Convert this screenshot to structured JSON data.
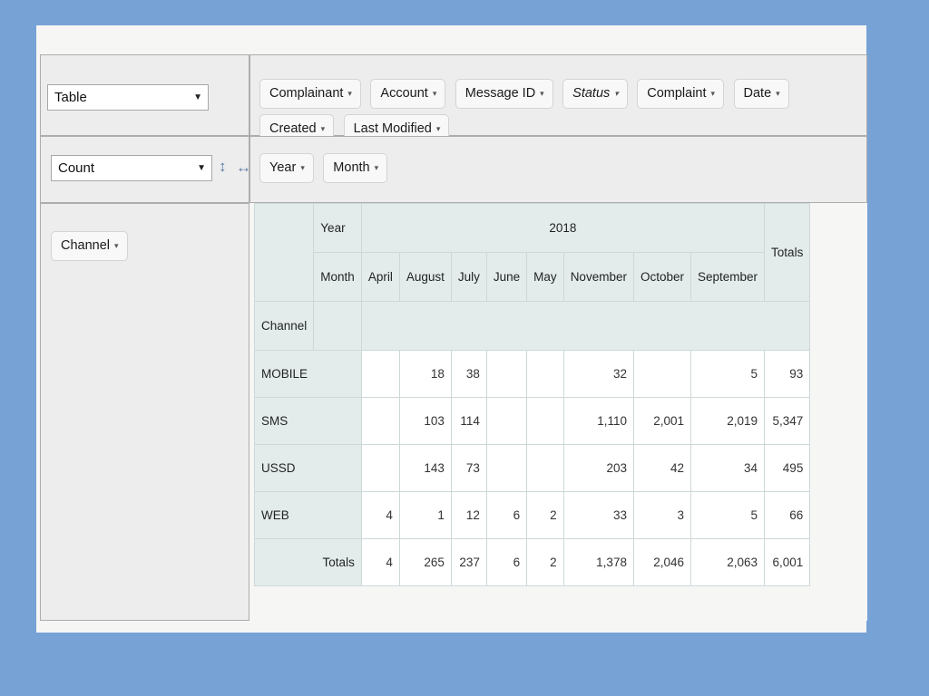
{
  "renderer": {
    "label": "Table",
    "caret": "▼"
  },
  "aggregator": {
    "label": "Count",
    "caret": "▼",
    "vertical_arrow_icon": "↕",
    "horizontal_arrow_icon": "↔"
  },
  "unused_attributes": [
    {
      "label": "Complainant",
      "caret": "▾",
      "italic": false
    },
    {
      "label": "Account",
      "caret": "▾",
      "italic": false
    },
    {
      "label": "Message ID",
      "caret": "▾",
      "italic": false
    },
    {
      "label": "Status",
      "caret": "▾",
      "italic": true
    },
    {
      "label": "Complaint",
      "caret": "▾",
      "italic": false
    },
    {
      "label": "Date",
      "caret": "▾",
      "italic": false
    },
    {
      "label": "Created",
      "caret": "▾",
      "italic": false
    },
    {
      "label": "Last Modified",
      "caret": "▾",
      "italic": false
    }
  ],
  "column_fields": [
    {
      "label": "Year",
      "caret": "▾"
    },
    {
      "label": "Month",
      "caret": "▾"
    }
  ],
  "row_fields": [
    {
      "label": "Channel",
      "caret": "▾"
    }
  ],
  "table": {
    "year_axis_label": "Year",
    "month_axis_label": "Month",
    "channel_axis_label": "Channel",
    "year_value": "2018",
    "totals_label": "Totals",
    "months": [
      "April",
      "August",
      "July",
      "June",
      "May",
      "November",
      "October",
      "September"
    ],
    "rows": [
      {
        "label": "MOBILE",
        "values": [
          "",
          "18",
          "38",
          "",
          "",
          "32",
          "",
          "5"
        ],
        "total": "93"
      },
      {
        "label": "SMS",
        "values": [
          "",
          "103",
          "114",
          "",
          "",
          "1,110",
          "2,001",
          "2,019"
        ],
        "total": "5,347"
      },
      {
        "label": "USSD",
        "values": [
          "",
          "143",
          "73",
          "",
          "",
          "203",
          "42",
          "34"
        ],
        "total": "495"
      },
      {
        "label": "WEB",
        "values": [
          "4",
          "1",
          "12",
          "6",
          "2",
          "33",
          "3",
          "5"
        ],
        "total": "66"
      }
    ],
    "totals_row": {
      "label": "Totals",
      "values": [
        "4",
        "265",
        "237",
        "6",
        "2",
        "1,378",
        "2,046",
        "2,063"
      ],
      "total": "6,001"
    }
  },
  "colors": {
    "background": "#76a2d6",
    "slide": "#f6f6f4",
    "panel": "#ededed",
    "header_cell": "#e4ebeb",
    "accent": "#5b7ba8"
  }
}
